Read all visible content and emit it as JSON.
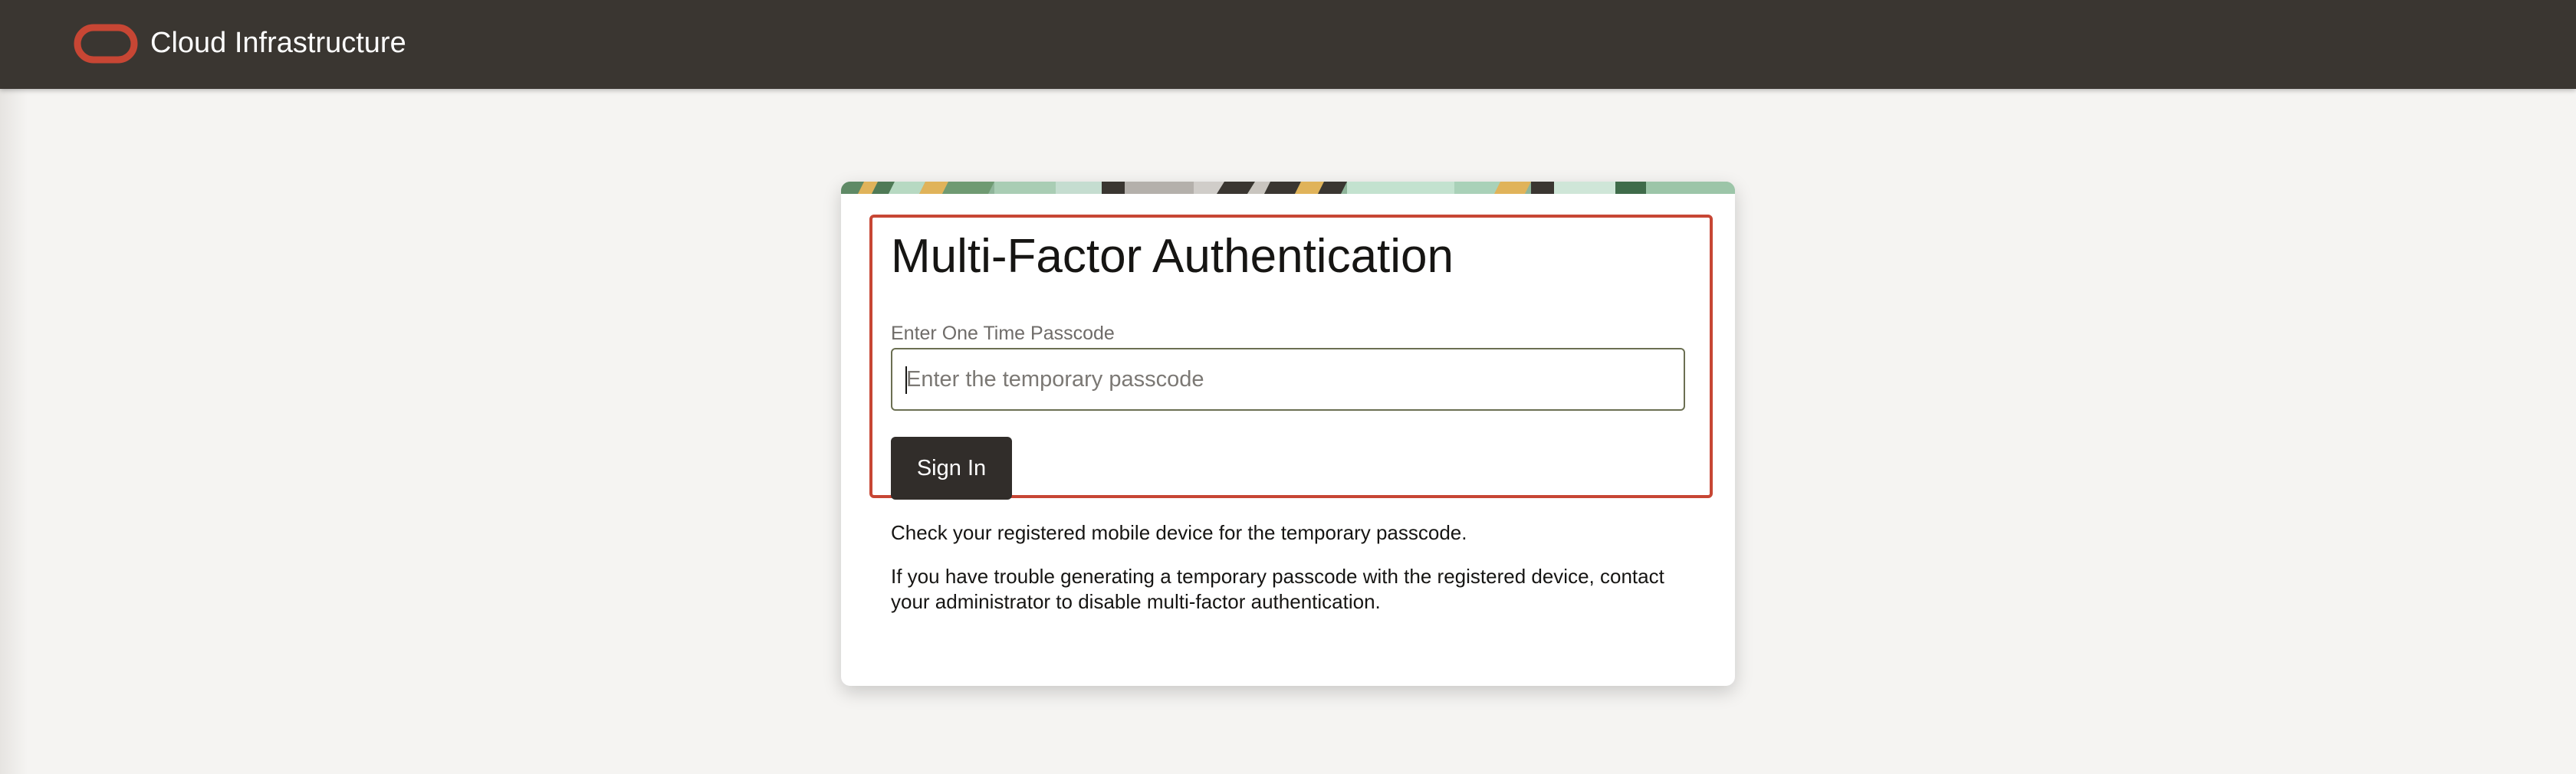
{
  "header": {
    "brand": "Cloud Infrastructure",
    "background_color": "#3a3631",
    "logo_icon": "oracle-ring-logo",
    "logo_color": "#c74634"
  },
  "card": {
    "title": "Multi-Factor Authentication",
    "focus_color": "#c74634",
    "passcode": {
      "label": "Enter One Time Passcode",
      "placeholder": "Enter the temporary passcode",
      "value": ""
    },
    "sign_in_label": "Sign In",
    "help": [
      "Check your registered mobile device for the temporary passcode.",
      "If you have trouble generating a temporary passcode with the registered device, contact your administrator to disable multi-factor authentication."
    ]
  }
}
